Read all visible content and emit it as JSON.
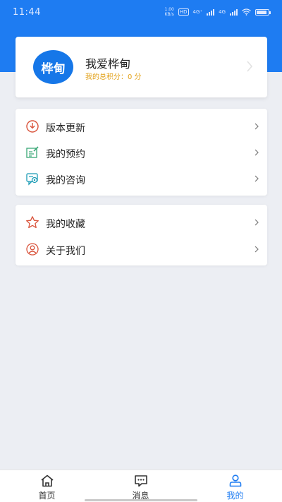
{
  "status_bar": {
    "time": "11:44",
    "speed_value": "1.00",
    "speed_unit": "KB/s",
    "hd_label": "HD",
    "network_1": "4G⁺",
    "network_2": "4G",
    "battery_level": 0.85
  },
  "profile": {
    "avatar_text": "桦甸",
    "name": "我爱桦甸",
    "points_text": "我的总积分：0 分"
  },
  "menu_group_1": [
    {
      "label": "版本更新",
      "icon": "download-circle-icon"
    },
    {
      "label": "我的预约",
      "icon": "edit-note-icon"
    },
    {
      "label": "我的咨询",
      "icon": "chat-screen-icon"
    }
  ],
  "menu_group_2": [
    {
      "label": "我的收藏",
      "icon": "star-icon"
    },
    {
      "label": "关于我们",
      "icon": "user-circle-icon"
    }
  ],
  "tabs": [
    {
      "label": "首页",
      "icon": "home-icon",
      "active": false
    },
    {
      "label": "消息",
      "icon": "message-icon",
      "active": false
    },
    {
      "label": "我的",
      "icon": "user-icon",
      "active": true
    }
  ],
  "colors": {
    "brand_blue": "#1e7cf2",
    "avatar_blue": "#1677e8",
    "points_gold": "#e3a21a",
    "icon_red": "#d9533b",
    "icon_green": "#3aa776",
    "icon_teal": "#1b9bb5"
  }
}
